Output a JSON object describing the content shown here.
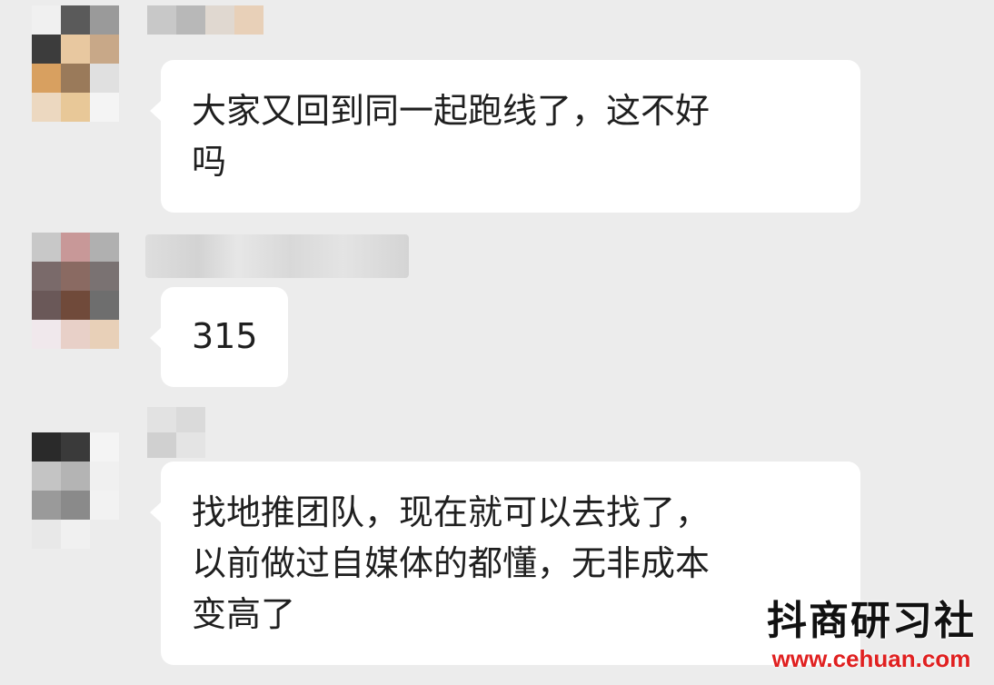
{
  "messages": [
    {
      "text": "大家又回到同一起跑线了，这不好\n吗"
    },
    {
      "text": "315"
    },
    {
      "text": "找地推团队，现在就可以去找了，\n以前做过自媒体的都懂，无非成本\n变高了"
    }
  ],
  "watermark": {
    "title": "抖商研习社",
    "url": "www.cehuan.com"
  },
  "colors": {
    "background": "#ececec",
    "bubble": "#ffffff",
    "text": "#1f1f1f",
    "watermark_url": "#e02020"
  }
}
